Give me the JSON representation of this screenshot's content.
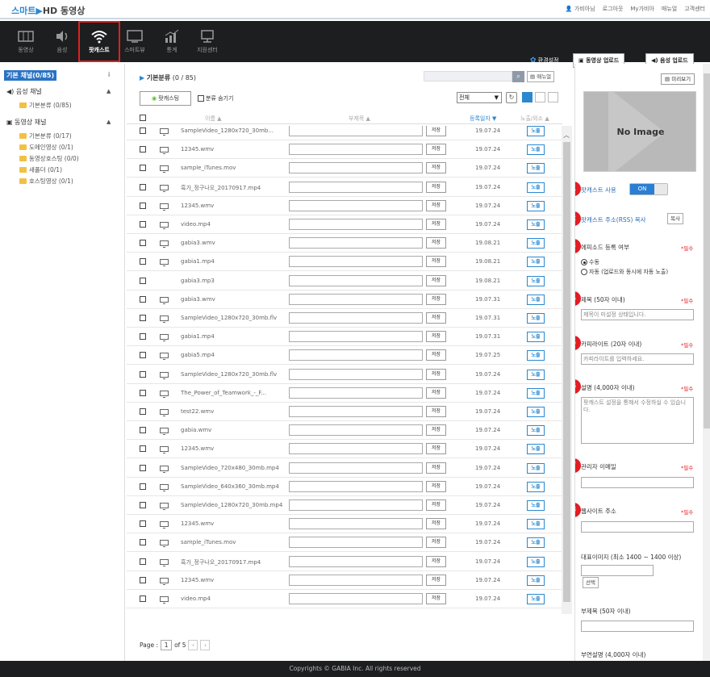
{
  "app": {
    "logo_prefix": "스마트",
    "logo_suffix": "HD 동영상"
  },
  "top_links": [
    "가비아님",
    "로그아웃",
    "My가비아",
    "매뉴얼",
    "고객센터"
  ],
  "nav": {
    "items": [
      {
        "label": "동영상",
        "icon": "film-icon"
      },
      {
        "label": "음성",
        "icon": "speaker-icon"
      },
      {
        "label": "팟캐스트",
        "icon": "wifi-icon"
      },
      {
        "label": "스마트뷰",
        "icon": "monitor-icon"
      },
      {
        "label": "통계",
        "icon": "chart-icon"
      },
      {
        "label": "지원센터",
        "icon": "support-icon"
      }
    ],
    "settings": "환경설정",
    "video_upload": "동영상 업로드",
    "audio_upload": "음성 업로드"
  },
  "sidebar": {
    "title": "기본 채널(0/85)",
    "info": "i",
    "audio_channel": "음성 채널",
    "audio_items": [
      "기본분류 (0/85)"
    ],
    "video_channel": "동영상 채널",
    "video_items": [
      "기본분류 (0/17)",
      "도메인영상 (0/1)",
      "동영상호스팅 (0/0)",
      "새폴더 (0/1)",
      "호스팅영상 (0/1)"
    ]
  },
  "main": {
    "title_name": "기본분류",
    "title_count": "(0 / 85)",
    "search_icon": "search-icon",
    "manual_btn": "매뉴얼",
    "podcast_btn": "팟캐스팅",
    "hide_category": "분류 숨기기",
    "filter_value": "전체",
    "col_name": "이름 ▲",
    "col_sub": "부제목 ▲",
    "col_date": "등록일자 ▼",
    "col_expose": "노출/외소 ▲",
    "save_label": "저장",
    "expose_label": "노출",
    "rows": [
      {
        "name": "SampleVideo_1280x720_30mb...",
        "date": "19.07.24",
        "monitor": true
      },
      {
        "name": "12345.wmv",
        "date": "19.07.24",
        "monitor": true
      },
      {
        "name": "sample_iTunes.mov",
        "date": "19.07.24",
        "monitor": true
      },
      {
        "name": "흑가_정구나오_20170917.mp4",
        "date": "19.07.24",
        "monitor": true
      },
      {
        "name": "12345.wmv",
        "date": "19.07.24",
        "monitor": true
      },
      {
        "name": "video.mp4",
        "date": "19.07.24",
        "monitor": true
      },
      {
        "name": "gabia3.wmv",
        "date": "19.08.21",
        "monitor": true
      },
      {
        "name": "gabia1.mp4",
        "date": "19.08.21",
        "monitor": true
      },
      {
        "name": "gabia3.mp3",
        "date": "19.08.21",
        "monitor": false
      },
      {
        "name": "gabia3.wmv",
        "date": "19.07.31",
        "monitor": true
      },
      {
        "name": "SampleVideo_1280x720_30mb.flv",
        "date": "19.07.31",
        "monitor": true
      },
      {
        "name": "gabia1.mp4",
        "date": "19.07.31",
        "monitor": true
      },
      {
        "name": "gabia5.mp4",
        "date": "19.07.25",
        "monitor": true
      },
      {
        "name": "SampleVideo_1280x720_30mb.flv",
        "date": "19.07.24",
        "monitor": true
      },
      {
        "name": "The_Power_of_Teamwork_-_F...",
        "date": "19.07.24",
        "monitor": true
      },
      {
        "name": "test22.wmv",
        "date": "19.07.24",
        "monitor": true
      },
      {
        "name": "gabia.wmv",
        "date": "19.07.24",
        "monitor": true
      },
      {
        "name": "12345.wmv",
        "date": "19.07.24",
        "monitor": true
      },
      {
        "name": "SampleVideo_720x480_30mb.mp4",
        "date": "19.07.24",
        "monitor": true
      },
      {
        "name": "SampleVideo_640x360_30mb.mp4",
        "date": "19.07.24",
        "monitor": true
      },
      {
        "name": "SampleVideo_1280x720_30mb.mp4",
        "date": "19.07.24",
        "monitor": true
      },
      {
        "name": "12345.wmv",
        "date": "19.07.24",
        "monitor": true
      },
      {
        "name": "sample_iTunes.mov",
        "date": "19.07.24",
        "monitor": true
      },
      {
        "name": "흑가_정구나오_20170917.mp4",
        "date": "19.07.24",
        "monitor": true
      },
      {
        "name": "12345.wmv",
        "date": "19.07.24",
        "monitor": true
      },
      {
        "name": "video.mp4",
        "date": "19.07.24",
        "monitor": true
      }
    ],
    "pager": {
      "label": "Page :",
      "current": "1",
      "of": "of 5"
    }
  },
  "panel": {
    "preview_btn": "미리보기",
    "no_image": "No Image",
    "required": "*필수",
    "f1": {
      "num": "1",
      "label": "팟캐스트 사용",
      "toggle": "ON"
    },
    "f2": {
      "num": "2",
      "label": "팟캐스트 주소(RSS) 복사",
      "btn": "복사"
    },
    "f3": {
      "num": "3",
      "label": "에피소드 등록 여부",
      "opt1": "수동",
      "opt2": "자동 (업로드와 동시에 자동 노출)"
    },
    "f4": {
      "num": "4",
      "label": "제목 (50자 이내)",
      "value": "제목이 미설정 상태입니다."
    },
    "f5": {
      "num": "5",
      "label": "카피라이트 (20자 이내)",
      "value": "카피라이트를 입력하세요."
    },
    "f6": {
      "num": "6",
      "label": "설명 (4,000자 이내)",
      "value": "팟캐스트 설정을 통해서 수정하실 수 있습니다."
    },
    "f7": {
      "num": "7",
      "label": "관리자 이메일"
    },
    "f8": {
      "num": "8",
      "label": "웹사이트 주소"
    },
    "rep_image": "대표이미지 (최소 1400 ~ 1400 이상)",
    "choose_btn": "선택",
    "subtitle": "부제목 (50자 이내)",
    "sub_desc": "부연설명 (4,000자 이내)"
  },
  "footer": "Copyrights © GABIA Inc. All rights reserved"
}
